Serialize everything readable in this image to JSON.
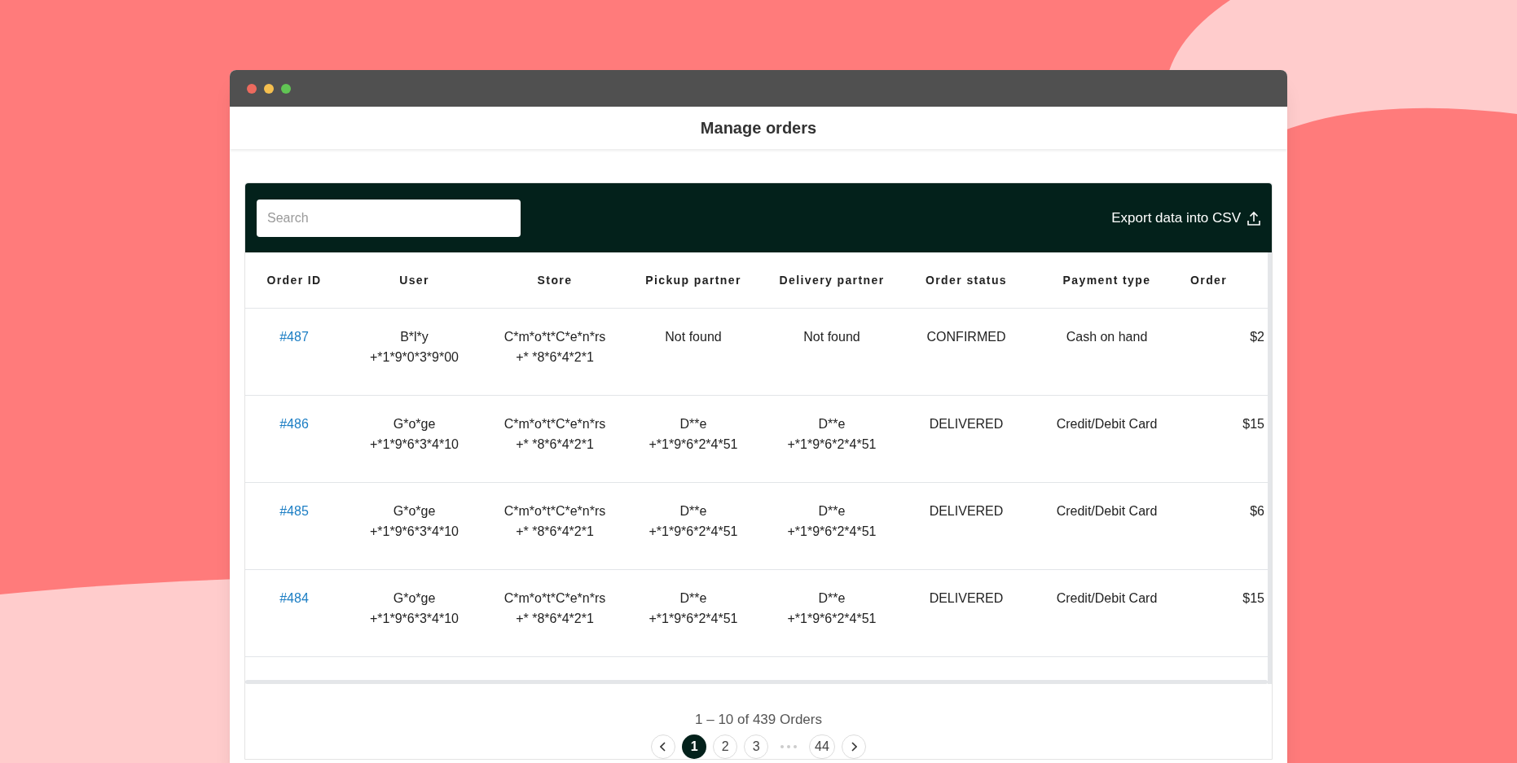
{
  "window": {
    "title": "Manage orders"
  },
  "toolbar": {
    "search": {
      "placeholder": "Search"
    },
    "export_button": {
      "label": "Export data into CSV"
    }
  },
  "table": {
    "columns": [
      "Order ID",
      "User",
      "Store",
      "Pickup partner",
      "Delivery partner",
      "Order status",
      "Payment type",
      "Order"
    ],
    "rows": [
      {
        "cells": [
          [
            "#487"
          ],
          [
            "B*l*y",
            "+*1*9*0*3*9*00"
          ],
          [
            "C*m*o*t*C*e*n*rs",
            "+* *8*6*4*2*1"
          ],
          [
            "Not found"
          ],
          [
            "Not found"
          ],
          [
            "CONFIRMED"
          ],
          [
            "Cash on hand"
          ],
          [
            "$2"
          ]
        ]
      },
      {
        "cells": [
          [
            "#486"
          ],
          [
            "G*o*ge",
            "+*1*9*6*3*4*10"
          ],
          [
            "C*m*o*t*C*e*n*rs",
            "+* *8*6*4*2*1"
          ],
          [
            "D**e",
            "+*1*9*6*2*4*51"
          ],
          [
            "D**e",
            "+*1*9*6*2*4*51"
          ],
          [
            "DELIVERED"
          ],
          [
            "Credit/Debit Card"
          ],
          [
            "$15"
          ]
        ]
      },
      {
        "cells": [
          [
            "#485"
          ],
          [
            "G*o*ge",
            "+*1*9*6*3*4*10"
          ],
          [
            "C*m*o*t*C*e*n*rs",
            "+* *8*6*4*2*1"
          ],
          [
            "D**e",
            "+*1*9*6*2*4*51"
          ],
          [
            "D**e",
            "+*1*9*6*2*4*51"
          ],
          [
            "DELIVERED"
          ],
          [
            "Credit/Debit Card"
          ],
          [
            "$6"
          ]
        ]
      },
      {
        "cells": [
          [
            "#484"
          ],
          [
            "G*o*ge",
            "+*1*9*6*3*4*10"
          ],
          [
            "C*m*o*t*C*e*n*rs",
            "+* *8*6*4*2*1"
          ],
          [
            "D**e",
            "+*1*9*6*2*4*51"
          ],
          [
            "D**e",
            "+*1*9*6*2*4*51"
          ],
          [
            "DELIVERED"
          ],
          [
            "Credit/Debit Card"
          ],
          [
            "$15"
          ]
        ]
      }
    ]
  },
  "pagination": {
    "summary": "1 – 10 of 439 Orders",
    "items": [
      {
        "kind": "prev"
      },
      {
        "kind": "page",
        "label": "1",
        "selected": true
      },
      {
        "kind": "page",
        "label": "2",
        "selected": false
      },
      {
        "kind": "page",
        "label": "3",
        "selected": false
      },
      {
        "kind": "ellipsis"
      },
      {
        "kind": "page",
        "label": "44",
        "selected": false
      },
      {
        "kind": "next"
      }
    ]
  }
}
